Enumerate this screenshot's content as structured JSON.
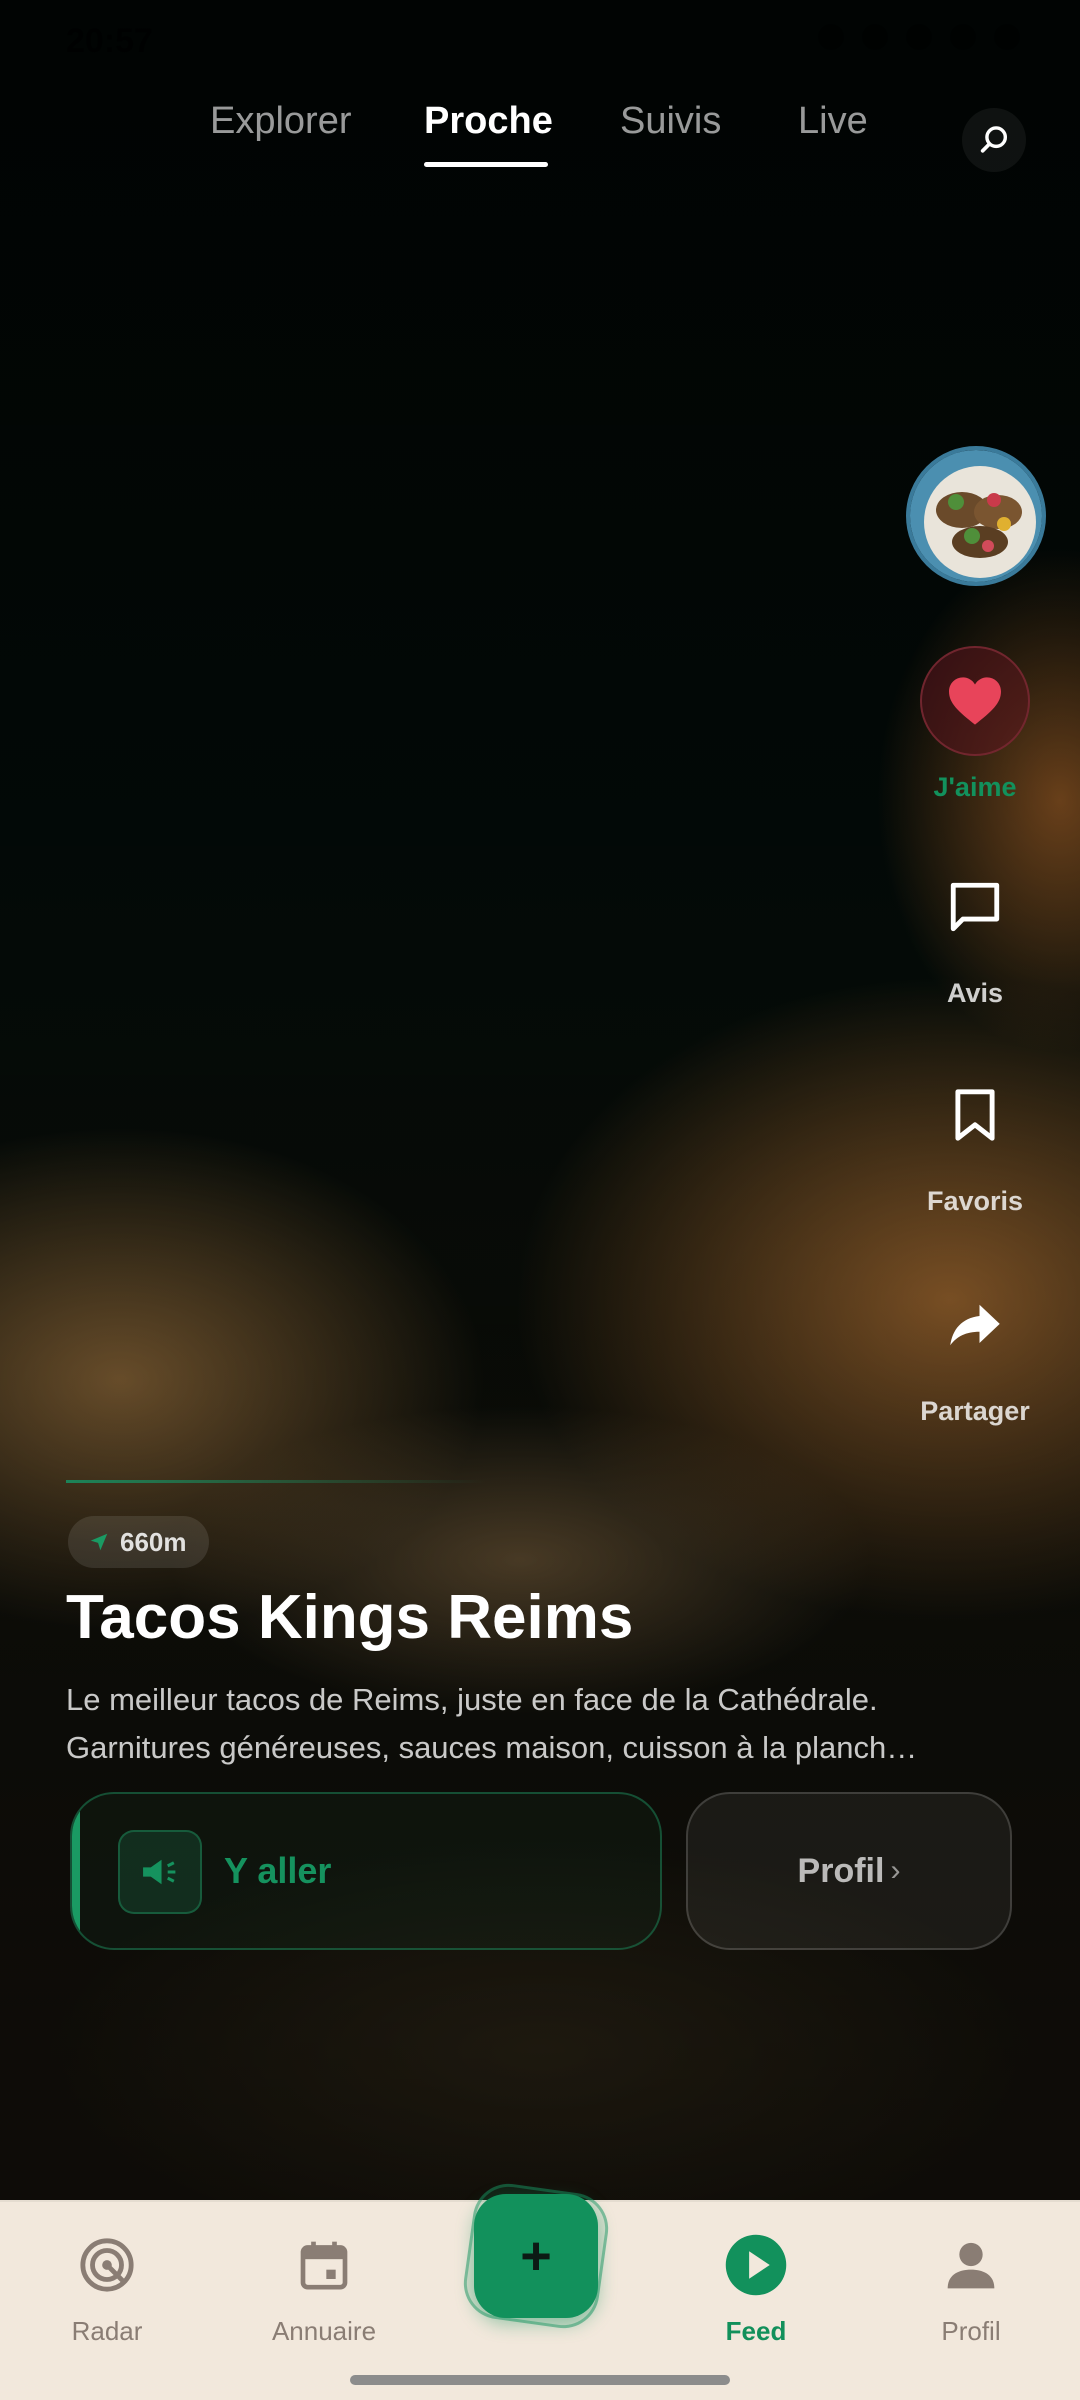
{
  "status_bar": {
    "time": "20:57"
  },
  "top_tabs": {
    "items": [
      {
        "label": "Explorer",
        "active": false
      },
      {
        "label": "Proche",
        "active": true
      },
      {
        "label": "Suivis",
        "active": false
      },
      {
        "label": "Live",
        "active": false
      }
    ],
    "search_icon": "search-icon"
  },
  "actions": {
    "like_label": "J'aime",
    "reviews_label": "Avis",
    "favorites_label": "Favoris",
    "share_label": "Partager"
  },
  "post": {
    "distance": "660m",
    "title": "Tacos Kings Reims",
    "description_line1": "Le meilleur tacos de Reims, juste en face de la Cathédrale.",
    "description_line2": "Garnitures généreuses, sauces maison, cuisson à la planch…",
    "go_label": "Y aller",
    "profile_label": "Profil",
    "profile_chevron": "›"
  },
  "bottom_nav": {
    "items": [
      {
        "label": "Radar",
        "icon": "radar-icon"
      },
      {
        "label": "Annuaire",
        "icon": "calendar-icon"
      },
      {
        "label": "Feed",
        "icon": "play-icon",
        "active": true
      },
      {
        "label": "Profil",
        "icon": "person-icon"
      }
    ],
    "fab_symbol": "+"
  },
  "colors": {
    "accent": "#12915c",
    "like": "#e8445a",
    "nav_background": "#f2e8dc",
    "nav_inactive": "#8a7d74"
  }
}
